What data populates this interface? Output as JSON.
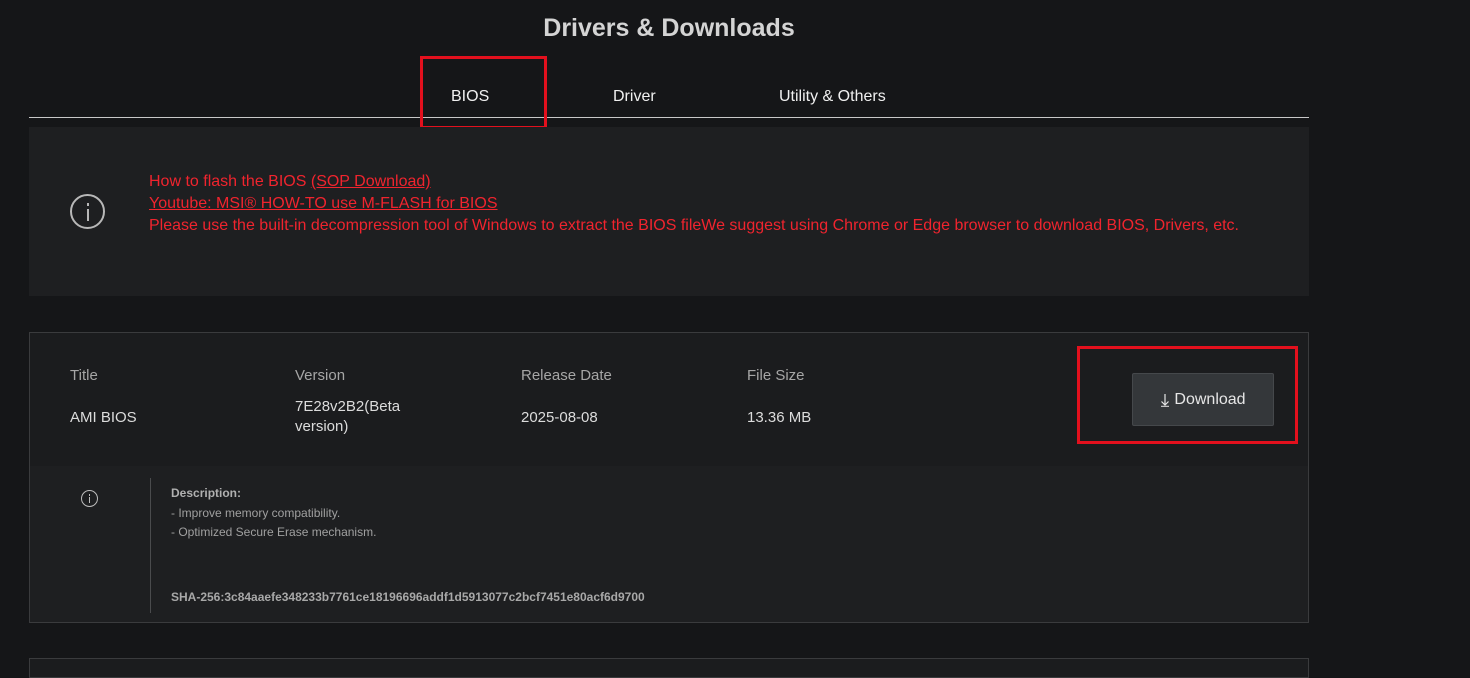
{
  "page": {
    "title": "Drivers & Downloads"
  },
  "tabs": [
    {
      "label": "BIOS",
      "active": true
    },
    {
      "label": "Driver"
    },
    {
      "label": "Utility & Others"
    }
  ],
  "notice": {
    "line1_text": "How to flash the BIOS ",
    "line1_link": "(SOP Download)",
    "line2_link": "Youtube: MSI® HOW-TO use M-FLASH for BIOS",
    "line3_text": "Please use the built-in decompression tool of Windows to extract the BIOS fileWe suggest using Chrome or Edge browser to download BIOS, Drivers, etc.",
    "icon": "info-circle-icon"
  },
  "bios_entry": {
    "headers": {
      "title": "Title",
      "version": "Version",
      "release_date": "Release Date",
      "file_size": "File Size"
    },
    "title": "AMI BIOS",
    "version": "7E28v2B2(Beta version)",
    "release_date": "2025-08-08",
    "file_size": "13.36 MB",
    "download_label": "Download",
    "description": {
      "heading": "Description:",
      "lines": [
        "- Improve memory compatibility.",
        "- Optimized Secure Erase mechanism."
      ],
      "sha": "SHA-256:3c84aaefe348233b7761ce18196696addf1d5913077c2bcf7451e80acf6d9700"
    }
  },
  "colors": {
    "highlight": "#e3101d",
    "notice_text": "#f0242e",
    "background": "#151618"
  }
}
